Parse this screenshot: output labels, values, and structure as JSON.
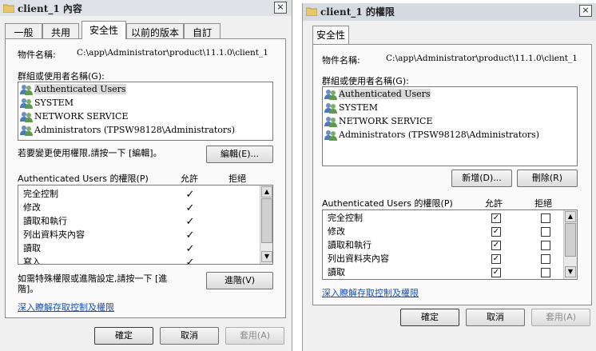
{
  "left_dialog": {
    "title": "client_1 內容",
    "close_label": "×",
    "tabs": [
      "一般",
      "共用",
      "安全性",
      "以前的版本",
      "自訂"
    ],
    "object_label": "物件名稱:",
    "object_path": "C:\\app\\Administrator\\product\\11.1.0\\client_1",
    "group_label": "群組或使用者名稱(G):",
    "users": [
      "Authenticated Users",
      "SYSTEM",
      "NETWORK SERVICE",
      "Administrators (TPSW98128\\Administrators)"
    ],
    "edit_hint": "若要變更使用權限,請按一下 [編輯]。",
    "edit_button": "編輯(E)...",
    "permissions_label": "Authenticated Users 的權限(P)",
    "allow_header": "允許",
    "deny_header": "拒絕",
    "permissions": [
      {
        "name": "完全控制",
        "allow": "✓",
        "deny": ""
      },
      {
        "name": "修改",
        "allow": "✓",
        "deny": ""
      },
      {
        "name": "讀取和執行",
        "allow": "✓",
        "deny": ""
      },
      {
        "name": "列出資料夾內容",
        "allow": "✓",
        "deny": ""
      },
      {
        "name": "讀取",
        "allow": "✓",
        "deny": ""
      },
      {
        "name": "寫入",
        "allow": "✓",
        "deny": ""
      }
    ],
    "advanced_hint_line1": "如需特殊權限或進階設定,請按一下 [進",
    "advanced_hint_line2": "階]。",
    "advanced_button": "進階(V)",
    "learn_link": "深入瞭解存取控制及權限",
    "ok_button": "確定",
    "cancel_button": "取消",
    "apply_button": "套用(A)"
  },
  "right_dialog": {
    "title": "client_1 的權限",
    "close_label": "×",
    "tab": "安全性",
    "object_label": "物件名稱:",
    "object_path": "C:\\app\\Administrator\\product\\11.1.0\\client_1",
    "group_label": "群組或使用者名稱(G):",
    "users": [
      "Authenticated Users",
      "SYSTEM",
      "NETWORK SERVICE",
      "Administrators (TPSW98128\\Administrators)"
    ],
    "add_button": "新增(D)...",
    "remove_button": "刪除(R)",
    "permissions_label": "Authenticated Users 的權限(P)",
    "allow_header": "允許",
    "deny_header": "拒絕",
    "permissions": [
      {
        "name": "完全控制",
        "allow": "✓",
        "deny": ""
      },
      {
        "name": "修改",
        "allow": "✓",
        "deny": ""
      },
      {
        "name": "讀取和執行",
        "allow": "✓",
        "deny": ""
      },
      {
        "name": "列出資料夾內容",
        "allow": "✓",
        "deny": ""
      },
      {
        "name": "讀取",
        "allow": "✓",
        "deny": ""
      }
    ],
    "learn_link": "深入瞭解存取控制及權限",
    "ok_button": "確定",
    "cancel_button": "取消",
    "apply_button": "套用(A)"
  }
}
